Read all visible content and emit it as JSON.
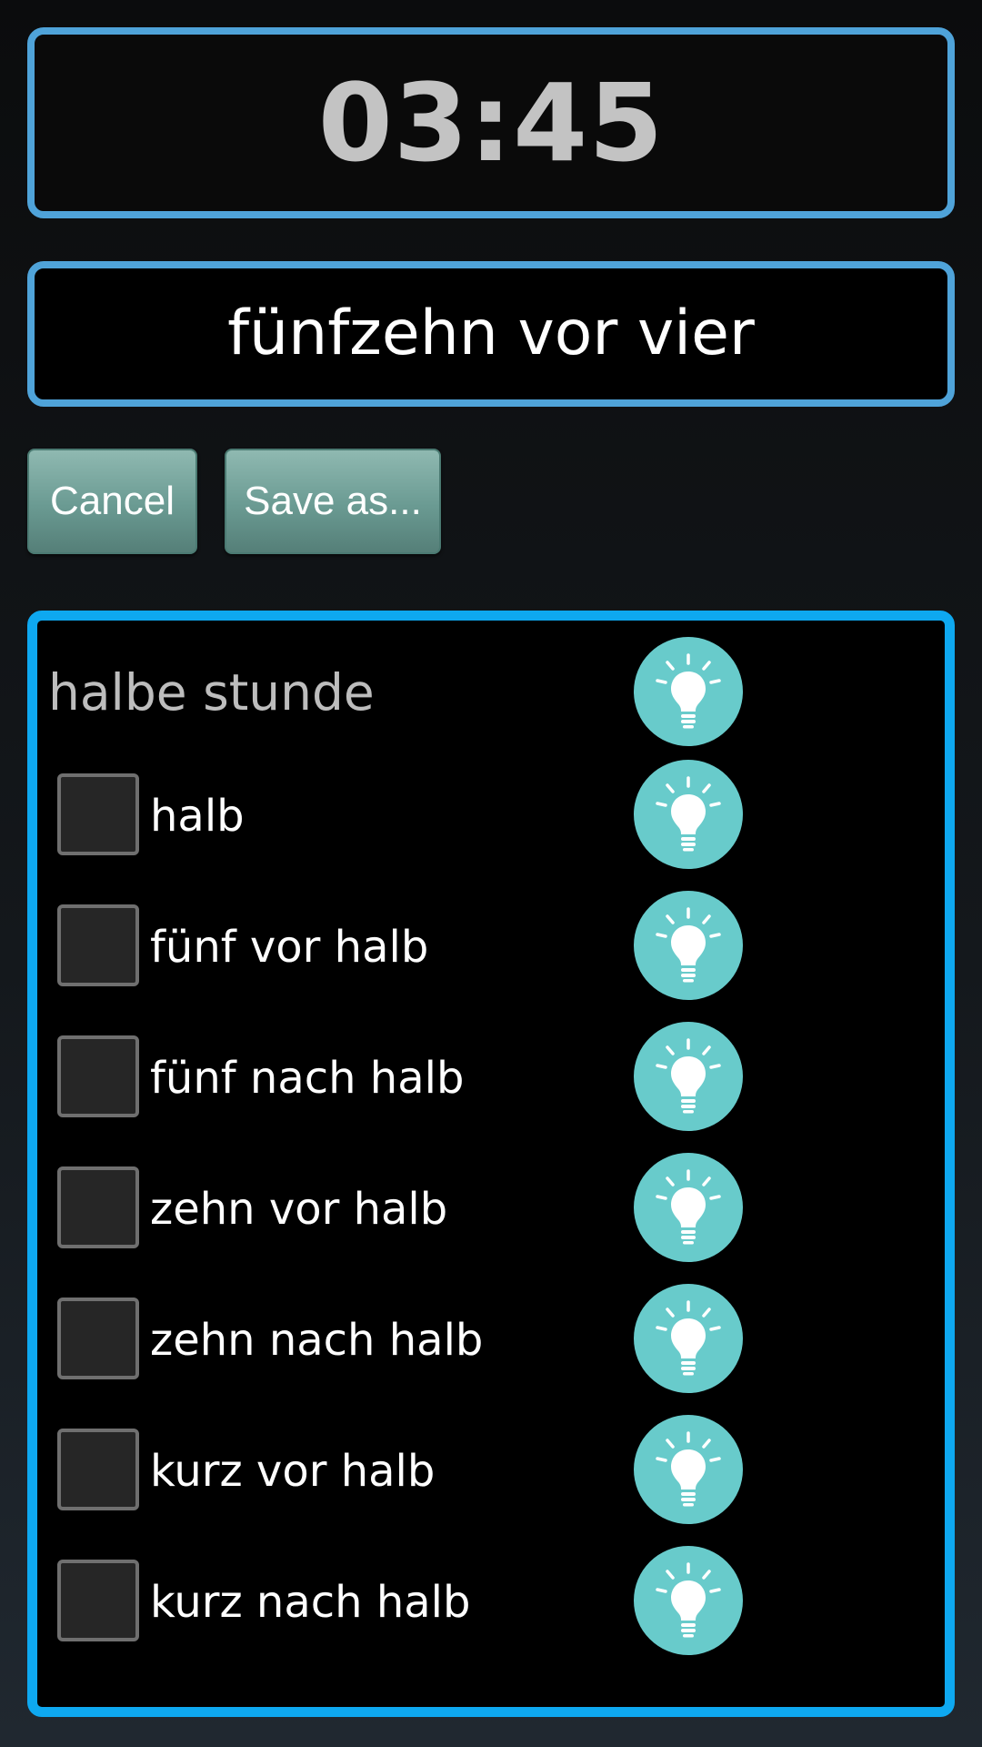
{
  "clock": {
    "time": "03:45"
  },
  "phrase": {
    "text": "fünfzehn vor vier"
  },
  "buttons": {
    "cancel": "Cancel",
    "save_as": "Save as..."
  },
  "group": {
    "title": "halbe stunde",
    "title_icon": "lightbulb-icon",
    "items": [
      {
        "label": "halb",
        "checked": false,
        "icon": "lightbulb-icon"
      },
      {
        "label": "fünf vor halb",
        "checked": false,
        "icon": "lightbulb-icon"
      },
      {
        "label": "fünf nach halb",
        "checked": false,
        "icon": "lightbulb-icon"
      },
      {
        "label": "zehn vor halb",
        "checked": false,
        "icon": "lightbulb-icon"
      },
      {
        "label": "zehn nach halb",
        "checked": false,
        "icon": "lightbulb-icon"
      },
      {
        "label": "kurz vor halb",
        "checked": false,
        "icon": "lightbulb-icon"
      },
      {
        "label": "kurz nach halb",
        "checked": false,
        "icon": "lightbulb-icon"
      }
    ]
  },
  "colors": {
    "frame_blue": "#4fa3d9",
    "panel_blue": "#0ea8f0",
    "bulb_teal": "#68cbcb",
    "button_green": "#6a9a92"
  }
}
